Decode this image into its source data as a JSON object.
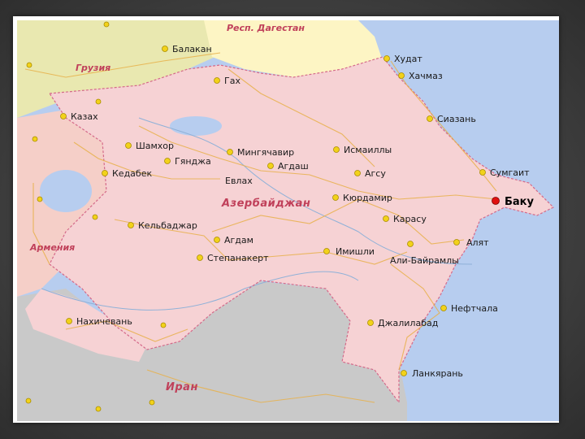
{
  "map": {
    "regions": {
      "dagestan": "Респ. Дагестан",
      "georgia": "Грузия",
      "azerbaijan": "Азербайджан",
      "armenia": "Армения",
      "iran": "Иран"
    },
    "capital": "Баку",
    "cities": [
      "Балакан",
      "Худат",
      "Хачмаз",
      "Гах",
      "Казах",
      "Сиазань",
      "Шамхор",
      "Мингячавир",
      "Исмаиллы",
      "Гянджа",
      "Агдаш",
      "Кедабек",
      "Агсу",
      "Сумгаит",
      "Евлах",
      "Кюрдамир",
      "Карасу",
      "Кельбаджар",
      "Агдам",
      "Алят",
      "Имишли",
      "Степанакерт",
      "Али-Байрамлы",
      "Нефтчала",
      "Нахичевань",
      "Джалилабад",
      "Ланкярань"
    ],
    "colors": {
      "azerbaijan": "#f6d2d4",
      "georgia": "#e9e8b0",
      "dagestan": "#fdf5c4",
      "armenia": "#f5cfc8",
      "iran": "#c9c9c9",
      "sea": "#b7cdef",
      "city_marker": "#f2d21a",
      "capital_marker": "#e01010"
    }
  }
}
